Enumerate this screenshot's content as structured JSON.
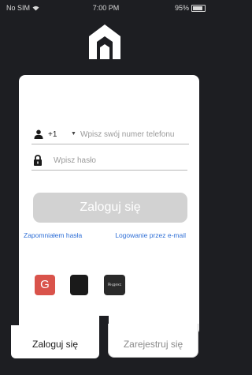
{
  "status_bar": {
    "carrier": "No SIM",
    "time": "7:00 PM",
    "battery": "95%"
  },
  "phone": {
    "country_code": "+1",
    "placeholder": "Wpisz swój numer telefonu"
  },
  "password": {
    "placeholder": "Wpisz hasło"
  },
  "login_button": {
    "label": "Zaloguj się"
  },
  "links": {
    "forgot_password": "Zapomniałem hasła",
    "email_login": "Logowanie przez e-mail"
  },
  "social": {
    "google": "G",
    "apple": "",
    "yandex": "Яндекс"
  },
  "tabs": {
    "login": "Zaloguj się",
    "register": "Zarejestruj się"
  },
  "colors": {
    "background": "#1d1e22",
    "link": "#2f6fd6",
    "google": "#d9534b",
    "button_disabled": "#d2d2d2"
  }
}
